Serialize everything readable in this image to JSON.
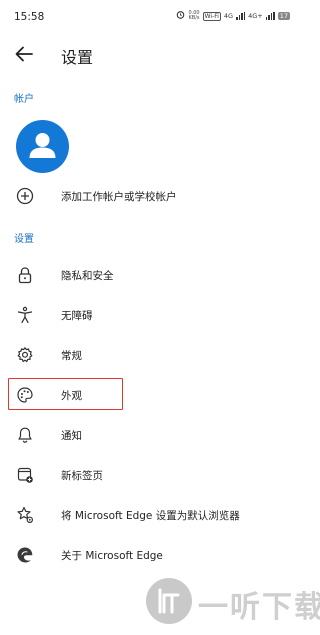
{
  "status_bar": {
    "time": "15:58",
    "speed_top": "0.00",
    "speed_bottom": "KB/s",
    "wifi_badge": "Wi-Fi",
    "signal_1": "4G",
    "signal_2": "4G+",
    "battery": "17"
  },
  "header": {
    "title": "设置"
  },
  "account_section": {
    "label": "帐户",
    "add_account_label": "添加工作帐户或学校帐户"
  },
  "settings_section": {
    "label": "设置",
    "items": [
      {
        "label": "隐私和安全",
        "icon": "lock-icon"
      },
      {
        "label": "无障碍",
        "icon": "accessibility-icon"
      },
      {
        "label": "常规",
        "icon": "gear-icon"
      },
      {
        "label": "外观",
        "icon": "palette-icon"
      },
      {
        "label": "通知",
        "icon": "bell-icon"
      },
      {
        "label": "新标签页",
        "icon": "new-tab-icon"
      },
      {
        "label": "将 Microsoft Edge 设置为默认浏览器",
        "icon": "star-settings-icon"
      },
      {
        "label": "关于 Microsoft Edge",
        "icon": "edge-logo-icon"
      }
    ]
  },
  "watermark": {
    "text": "一听下载"
  },
  "colors": {
    "accent": "#1a73c8",
    "avatar": "#1479d6",
    "highlight_border": "#e0362c"
  }
}
